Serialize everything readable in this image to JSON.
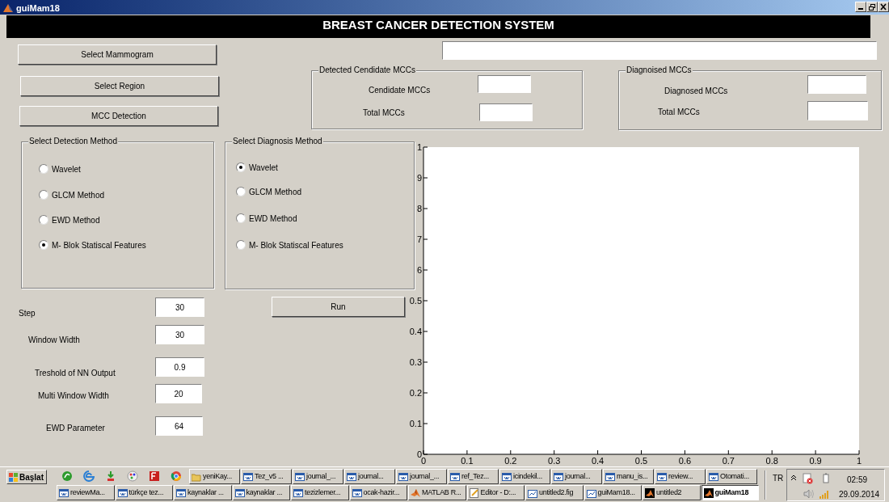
{
  "window": {
    "title": "guiMam18"
  },
  "header": {
    "title": "BREAST CANCER DETECTION SYSTEM"
  },
  "buttons": [
    {
      "label": "Select Mammogram"
    },
    {
      "label": "Select Region"
    },
    {
      "label": "MCC Detection"
    }
  ],
  "detected_panel": {
    "title": "Detected Cendidate MCCs",
    "rows": [
      {
        "label": "Cendidate MCCs"
      },
      {
        "label": "Total MCCs"
      }
    ]
  },
  "diagnosed_panel": {
    "title": "Diagnoised MCCs",
    "rows": [
      {
        "label": "Diagnosed MCCs"
      },
      {
        "label": "Total MCCs"
      }
    ]
  },
  "detection_method": {
    "title": "Select Detection Method",
    "options": [
      {
        "label": "Wavelet",
        "selected": false
      },
      {
        "label": "GLCM Method",
        "selected": false
      },
      {
        "label": "EWD Method",
        "selected": false
      },
      {
        "label": "M- Blok Statiscal Features",
        "selected": true
      }
    ]
  },
  "diagnosis_method": {
    "title": "Select Diagnosis Method",
    "options": [
      {
        "label": "Wavelet",
        "selected": true
      },
      {
        "label": "GLCM Method",
        "selected": false
      },
      {
        "label": "EWD Method",
        "selected": false
      },
      {
        "label": "M- Blok Statiscal Features",
        "selected": false
      }
    ]
  },
  "parameters": [
    {
      "label": "Step",
      "value": "30"
    },
    {
      "label": "Window Width",
      "value": "30"
    },
    {
      "label": "Treshold of NN Output",
      "value": "0.9"
    },
    {
      "label": "Multi Window Width",
      "value": "20"
    },
    {
      "label": "EWD Parameter",
      "value": "64"
    }
  ],
  "run_button": {
    "label": "Run"
  },
  "axes": {
    "chart_data": {
      "type": "line",
      "xlim": [
        0,
        1
      ],
      "ylim": [
        0,
        1
      ],
      "xticks": [
        0,
        0.1,
        0.2,
        0.3,
        0.4,
        0.5,
        0.6,
        0.7,
        0.8,
        0.9,
        1
      ],
      "yticks": [
        0,
        0.1,
        0.2,
        0.3,
        0.4,
        0.5,
        1
      ]
    },
    "covered_y_tick_labels": [
      "9",
      "8",
      "7",
      "6"
    ]
  },
  "taskbar": {
    "start": "Başlat",
    "row_1": [
      {
        "label": "yeniKay...",
        "kind": "folder",
        "selected": false
      },
      {
        "label": "Tez_v5 ...",
        "kind": "document",
        "selected": false
      },
      {
        "label": "journal_...",
        "kind": "document",
        "selected": false
      },
      {
        "label": "journal...",
        "kind": "document",
        "selected": false
      },
      {
        "label": "journal_...",
        "kind": "document",
        "selected": false
      },
      {
        "label": "ref_Tez...",
        "kind": "document",
        "selected": false
      },
      {
        "label": "icindekil...",
        "kind": "document",
        "selected": false
      },
      {
        "label": "journal...",
        "kind": "document",
        "selected": false
      },
      {
        "label": "manu_is...",
        "kind": "document",
        "selected": false
      },
      {
        "label": "review...",
        "kind": "document",
        "selected": false
      },
      {
        "label": "Otomati...",
        "kind": "document",
        "selected": false
      }
    ],
    "row_2": [
      {
        "label": "reviewMa...",
        "kind": "document",
        "selected": false
      },
      {
        "label": "türkçe tez...",
        "kind": "document",
        "selected": false
      },
      {
        "label": "kaynaklar ...",
        "kind": "document",
        "selected": false
      },
      {
        "label": "kaynaklar ...",
        "kind": "document",
        "selected": false
      },
      {
        "label": "tezizlemer...",
        "kind": "document",
        "selected": false
      },
      {
        "label": "ocak-hazir...",
        "kind": "document",
        "selected": false
      },
      {
        "label": "MATLAB R...",
        "kind": "matlab",
        "selected": false
      },
      {
        "label": "Editor - D:...",
        "kind": "editor",
        "selected": false
      },
      {
        "label": "untitled2.fig",
        "kind": "figfile",
        "selected": false
      },
      {
        "label": "guiMam18...",
        "kind": "figfile",
        "selected": false
      },
      {
        "label": "untitled2",
        "kind": "figure",
        "selected": false
      },
      {
        "label": "guiMam18",
        "kind": "figure",
        "selected": true
      }
    ],
    "language": "TR",
    "time": "02:59",
    "date": "29.09.2014"
  }
}
